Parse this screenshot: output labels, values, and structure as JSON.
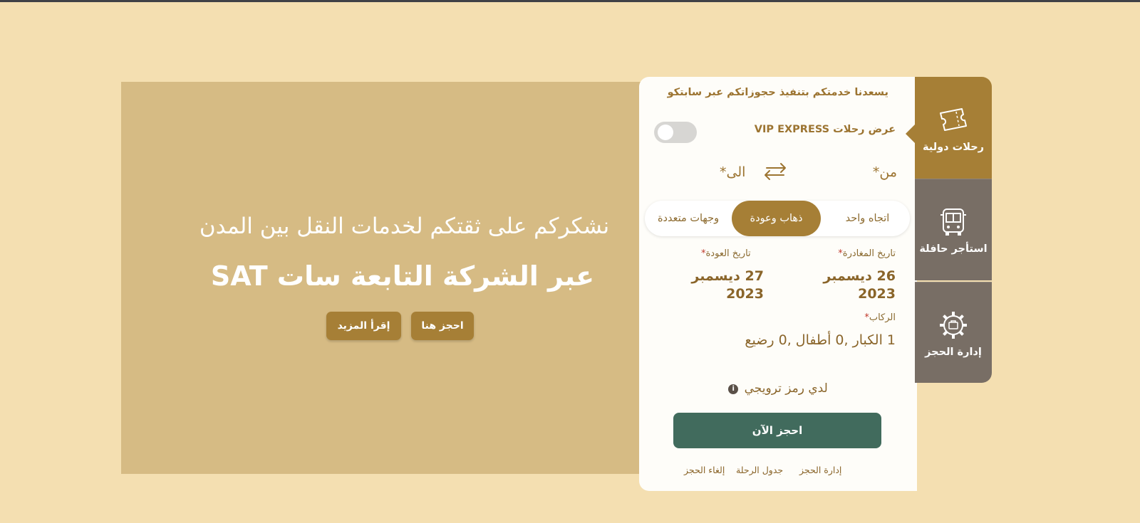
{
  "hero": {
    "line1": "نشكركم على ثقتكم لخدمات النقل بين المدن",
    "line2": "عبر الشركة التابعة سات SAT",
    "book_button": "احجز هنا",
    "more_button": "إقرأ المزيد"
  },
  "booking": {
    "title": "يسعدنا خدمتكم بتنفيذ حجوزاتكم عبر سابتكو",
    "vip_label": "عرض رحلات VIP EXPRESS",
    "from_label": "من",
    "to_label": "الى",
    "required_mark": "*",
    "trip_types": {
      "one_way": "اتجاه واحد",
      "round_trip": "ذهاب وعودة",
      "multi_city": "وجهات متعددة"
    },
    "departure_label": "تاريخ المغادرة",
    "departure_value": "26 ديسمبر 2023",
    "return_label": "تاريخ العودة",
    "return_value": "27 ديسمبر 2023",
    "passengers_label": "الركاب",
    "passengers_value": "1 الكبار ,0 أطفال ,0 رضيع",
    "promo_label": "لدي رمز ترويجي",
    "book_now": "احجز الآن",
    "links": {
      "manage": "إدارة الحجز",
      "schedule": "جدول الرحلة",
      "cancel": "إلغاء الحجز"
    }
  },
  "sidebar": {
    "tabs": [
      {
        "label": "رحلات دولية",
        "icon": "ticket-icon"
      },
      {
        "label": "استأجر حافلة",
        "icon": "bus-icon"
      },
      {
        "label": "إدارة الحجز",
        "icon": "gear-icon"
      }
    ]
  },
  "colors": {
    "background": "#f4dfb1",
    "accent": "#a67f36",
    "primary_button": "#416b5d",
    "tab_inactive": "#786e65"
  }
}
